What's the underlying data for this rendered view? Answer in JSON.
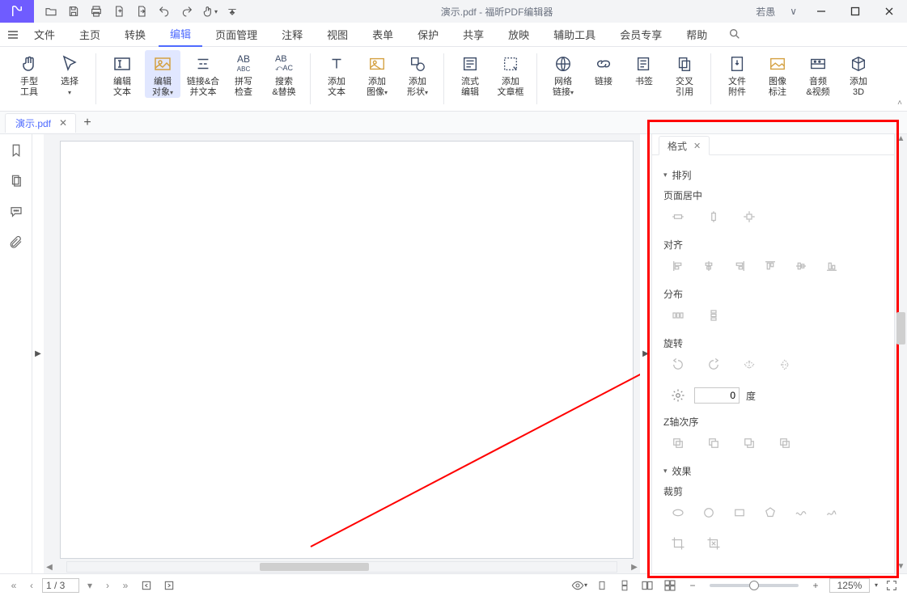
{
  "title": {
    "doc": "演示.pdf",
    "app": "福昕PDF编辑器",
    "full": "演示.pdf - 福昕PDF编辑器"
  },
  "user": "若愚",
  "menu": {
    "file": "文件",
    "items": [
      "主页",
      "转换",
      "编辑",
      "页面管理",
      "注释",
      "视图",
      "表单",
      "保护",
      "共享",
      "放映",
      "辅助工具",
      "会员专享",
      "帮助"
    ],
    "active_index": 2
  },
  "ribbon": {
    "hand": "手型\n工具",
    "select": "选择",
    "edit_text": "编辑\n文本",
    "edit_obj": "编辑\n对象",
    "link_merge": "链接&合\n并文本",
    "spell": "拼写\n检查",
    "search_replace": "搜索\n&替换",
    "add_text": "添加\n文本",
    "add_image": "添加\n图像",
    "add_shape": "添加\n形状",
    "flow_edit": "流式\n编辑",
    "add_article": "添加\n文章框",
    "web_link": "网络\n链接",
    "link": "链接",
    "bookmark": "书签",
    "crossref": "交叉\n引用",
    "attach": "文件\n附件",
    "image_mark": "图像\n标注",
    "av": "音频\n&视频",
    "add3d": "添加\n3D"
  },
  "doctab": {
    "name": "演示.pdf"
  },
  "format_panel": {
    "tab": "格式",
    "arrange": "排列",
    "page_center": "页面居中",
    "align": "对齐",
    "distribute": "分布",
    "rotate": "旋转",
    "degrees": "度",
    "angle": "0",
    "zorder": "Z轴次序",
    "effect": "效果",
    "crop": "裁剪"
  },
  "status": {
    "page": "1 / 3",
    "zoom": "125%"
  }
}
